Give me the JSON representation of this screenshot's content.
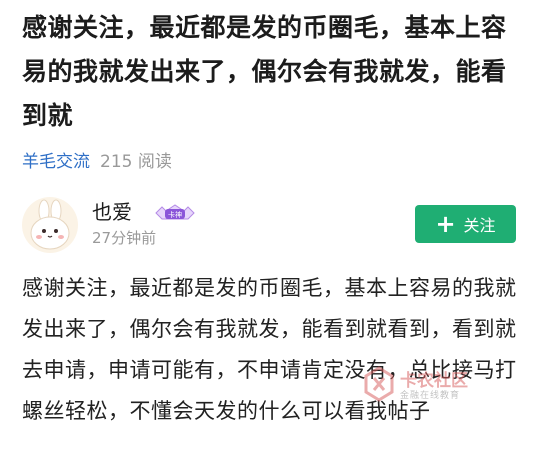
{
  "post": {
    "title": "感谢关注，最近都是发的币圈毛，基本上容易的我就发出来了，偶尔会有我就发，能看到就",
    "forum": "羊毛交流",
    "reads": "215 阅读",
    "content": "感谢关注，最近都是发的币圈毛，基本上容易的我就发出来了，偶尔会有我就发，能看到就看到，看到就去申请，申请可能有，不申请肯定没有，总比接马打螺丝轻松，不懂会天发的什么可以看我帖子"
  },
  "author": {
    "name": "也爱",
    "badge": "卡神",
    "time": "27分钟前",
    "avatar_icon": "bunny-avatar"
  },
  "follow_button": {
    "icon": "plus-icon",
    "label": "关注",
    "color": "#1fae73"
  },
  "watermark": {
    "line1": "卡农社区",
    "line2": "金融在线教育"
  }
}
